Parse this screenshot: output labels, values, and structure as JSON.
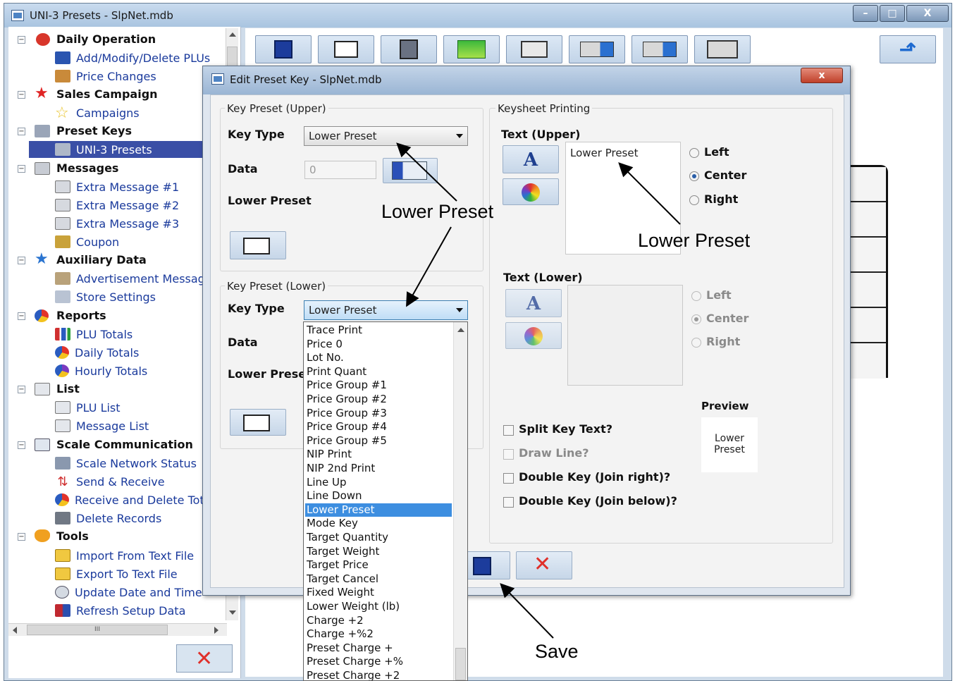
{
  "main_window": {
    "title": "UNI-3 Presets - SlpNet.mdb"
  },
  "tree": {
    "groups": [
      {
        "label": "Daily Operation",
        "items": [
          "Add/Modify/Delete PLUs",
          "Price Changes"
        ]
      },
      {
        "label": "Sales Campaign",
        "items": [
          "Campaigns"
        ]
      },
      {
        "label": "Preset Keys",
        "items": [
          "UNI-3 Presets"
        ]
      },
      {
        "label": "Messages",
        "items": [
          "Extra Message #1",
          "Extra Message #2",
          "Extra Message #3",
          "Coupon"
        ]
      },
      {
        "label": "Auxiliary Data",
        "items": [
          "Advertisement Message",
          "Store Settings"
        ]
      },
      {
        "label": "Reports",
        "items": [
          "PLU Totals",
          "Daily Totals",
          "Hourly Totals"
        ]
      },
      {
        "label": "List",
        "items": [
          "PLU List",
          "Message List"
        ]
      },
      {
        "label": "Scale Communication",
        "items": [
          "Scale Network Status",
          "Send & Receive",
          "Receive and Delete Totals"
        ]
      },
      {
        "label": "Tools",
        "items": [
          "Import From Text File",
          "Export To Text File",
          "Update Date and Time",
          "Refresh Setup Data"
        ]
      }
    ],
    "selected_item": "UNI-3 Presets",
    "hscroll_label": "III"
  },
  "dialog": {
    "title": "Edit Preset Key - SlpNet.mdb",
    "upper": {
      "group_title": "Key Preset (Upper)",
      "key_type_label": "Key Type",
      "key_type_value": "Lower Preset",
      "data_label": "Data",
      "data_value": "0",
      "sub_label": "Lower Preset"
    },
    "lower": {
      "group_title": "Key Preset (Lower)",
      "key_type_label": "Key Type",
      "key_type_value": "Lower Preset",
      "data_label": "Data",
      "sub_label": "Lower Preset"
    },
    "keysheet": {
      "group_title": "Keysheet Printing",
      "text_upper_label": "Text (Upper)",
      "text_upper_value": "Lower Preset",
      "text_lower_label": "Text (Lower)",
      "text_lower_value": "",
      "align_upper": [
        "Left",
        "Center",
        "Right"
      ],
      "align_lower": [
        "Left",
        "Center",
        "Right"
      ],
      "upper_selected": "Center",
      "lower_selected": "Center",
      "font_glyph": "A",
      "preview_label": "Preview",
      "preview_text_1": "Lower",
      "preview_text_2": "Preset",
      "checkboxes": [
        "Split Key Text?",
        "Draw Line?",
        "Double Key (Join right)?",
        "Double Key (Join below)?"
      ]
    },
    "close_glyph": "x",
    "cancel_glyph": "✕"
  },
  "dropdown": {
    "items": [
      "Trace Print",
      "Price 0",
      "Lot No.",
      "Print Quant",
      "Price Group #1",
      "Price Group #2",
      "Price Group #3",
      "Price Group #4",
      "Price Group #5",
      "NIP Print",
      "NIP 2nd Print",
      "Line Up",
      "Line Down",
      "Lower Preset",
      "Mode Key",
      "Target Quantity",
      "Target Weight",
      "Target Price",
      "Target Cancel",
      "Fixed Weight",
      "Lower Weight (lb)",
      "Charge +2",
      "Charge +%2",
      "Preset Charge +",
      "Preset Charge +%",
      "Preset Charge +2"
    ],
    "selected": "Lower Preset"
  },
  "annotations": {
    "callout_1": "Lower Preset",
    "callout_2": "Lower Preset",
    "callout_3": "Save"
  },
  "colors": {
    "selection": "#3a4fa6",
    "dropdown_selection": "#3d8ee0",
    "link_text": "#1a3a9c",
    "cancel_red": "#e0302a"
  }
}
